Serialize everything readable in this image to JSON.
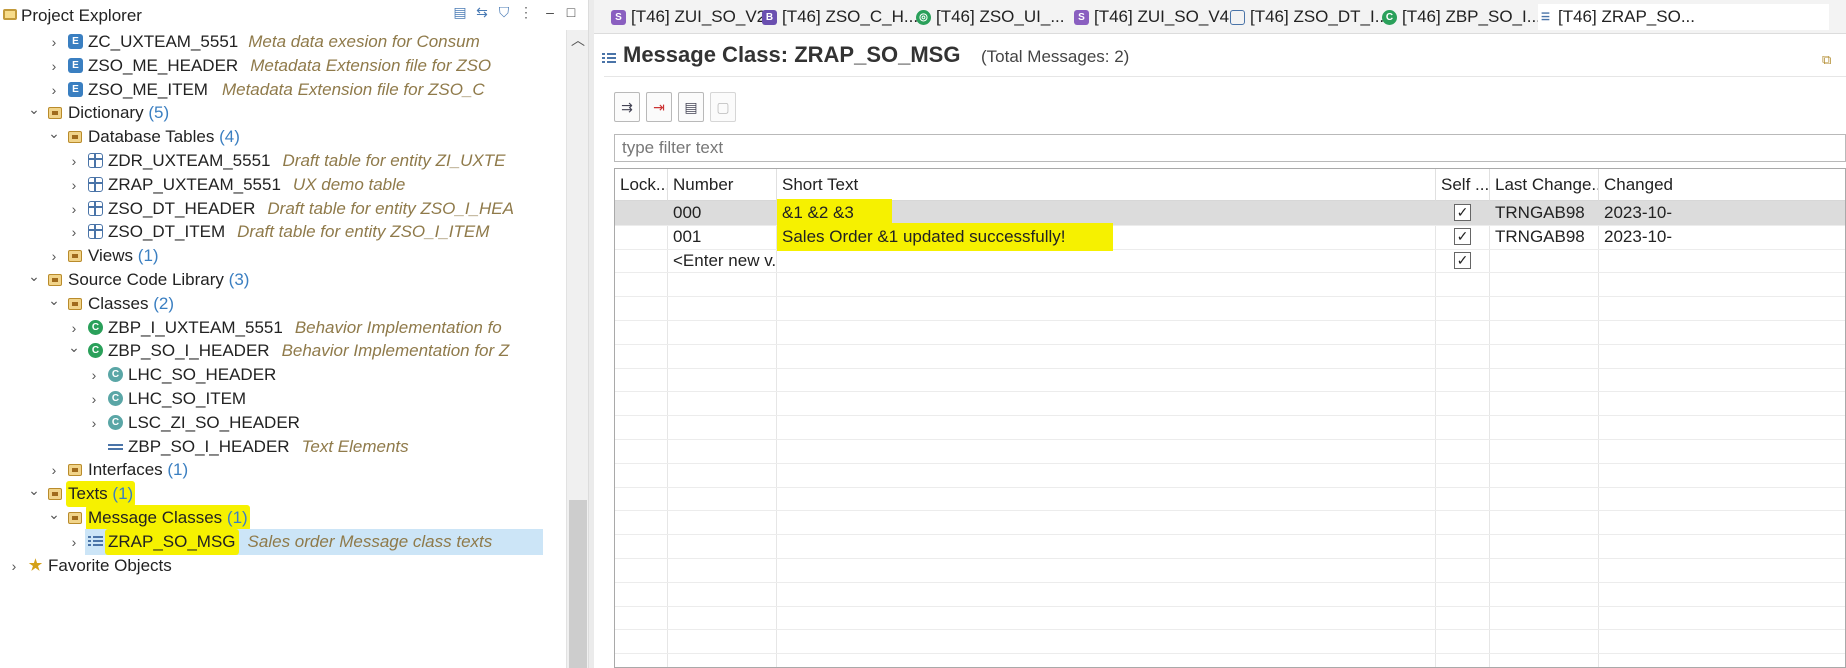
{
  "project_explorer": {
    "title": "Project Explorer",
    "tree": [
      {
        "id": "zc-uxteam",
        "name": "ZC_UXTEAM_5551",
        "desc": "Meta data exesion for Consum",
        "icon": "metadata-extension-icon",
        "expander": ">"
      },
      {
        "id": "zso-me-header",
        "name": "ZSO_ME_HEADER",
        "desc": "Metadata Extension file for ZSO",
        "icon": "metadata-extension-icon",
        "expander": ">"
      },
      {
        "id": "zso-me-item",
        "name": "ZSO_ME_ITEM",
        "desc": "Metadata Extension file for ZSO_C",
        "icon": "metadata-extension-icon",
        "expander": ">"
      },
      {
        "id": "dictionary",
        "name": "Dictionary",
        "count": "(5)",
        "icon": "package-folder-icon",
        "expander": "v"
      },
      {
        "id": "database-tables",
        "name": "Database Tables",
        "count": "(4)",
        "icon": "package-folder-icon",
        "expander": "v"
      },
      {
        "id": "zdr-uxteam",
        "name": "ZDR_UXTEAM_5551",
        "desc": "Draft table for entity ZI_UXTE",
        "icon": "table-icon",
        "expander": ">"
      },
      {
        "id": "zrap-uxteam",
        "name": "ZRAP_UXTEAM_5551",
        "desc": "UX demo table",
        "icon": "table-icon",
        "expander": ">"
      },
      {
        "id": "zso-dt-header",
        "name": "ZSO_DT_HEADER",
        "desc": "Draft table for entity ZSO_I_HEA",
        "icon": "table-icon",
        "expander": ">"
      },
      {
        "id": "zso-dt-item",
        "name": "ZSO_DT_ITEM",
        "desc": "Draft table for entity ZSO_I_ITEM",
        "icon": "table-icon",
        "expander": ">"
      },
      {
        "id": "views",
        "name": "Views",
        "count": "(1)",
        "icon": "package-folder-icon",
        "expander": ">"
      },
      {
        "id": "source-code-library",
        "name": "Source Code Library",
        "count": "(3)",
        "icon": "package-folder-icon",
        "expander": "v"
      },
      {
        "id": "classes",
        "name": "Classes",
        "count": "(2)",
        "icon": "package-folder-icon",
        "expander": "v"
      },
      {
        "id": "zbp-i-uxteam",
        "name": "ZBP_I_UXTEAM_5551",
        "desc": "Behavior Implementation fo",
        "icon": "class-icon",
        "expander": ">"
      },
      {
        "id": "zbp-so-i-header",
        "name": "ZBP_SO_I_HEADER",
        "desc": "Behavior Implementation for Z",
        "icon": "class-icon",
        "expander": "v"
      },
      {
        "id": "lhc-so-header",
        "name": "LHC_SO_HEADER",
        "icon": "local-class-icon",
        "expander": ">"
      },
      {
        "id": "lhc-so-item",
        "name": "LHC_SO_ITEM",
        "icon": "local-class-icon",
        "expander": ">"
      },
      {
        "id": "lsc-zi-so-header",
        "name": "LSC_ZI_SO_HEADER",
        "icon": "local-class-icon",
        "expander": ">"
      },
      {
        "id": "zbp-text-elements",
        "name": "ZBP_SO_I_HEADER",
        "desc": "Text Elements",
        "icon": "text-elements-icon",
        "expander": ""
      },
      {
        "id": "interfaces",
        "name": "Interfaces",
        "count": "(1)",
        "icon": "package-folder-icon",
        "expander": ">"
      },
      {
        "id": "texts",
        "name": "Texts",
        "count": "(1)",
        "icon": "package-folder-icon",
        "expander": "v"
      },
      {
        "id": "message-classes",
        "name": "Message Classes",
        "count": "(1)",
        "icon": "package-folder-icon",
        "expander": "v"
      },
      {
        "id": "zrap-so-msg",
        "name": "ZRAP_SO_MSG",
        "desc": "Sales order Message class texts",
        "icon": "message-class-icon",
        "expander": ">"
      },
      {
        "id": "favorite-objects",
        "name": "Favorite Objects",
        "icon": "star-icon",
        "expander": ">"
      }
    ]
  },
  "tabs": [
    {
      "label": "[T46] ZUI_SO_V2",
      "icon": "service-binding-icon",
      "color": "#8a5fc0"
    },
    {
      "label": "[T46] ZSO_C_H...",
      "icon": "behavior-definition-icon",
      "color": "#6a4fb0"
    },
    {
      "label": "[T46] ZSO_UI_...",
      "icon": "service-definition-icon",
      "color": "#2aa05a"
    },
    {
      "label": "[T46] ZUI_SO_V4",
      "icon": "service-binding-icon",
      "color": "#8a5fc0"
    },
    {
      "label": "[T46] ZSO_DT_I...",
      "icon": "table-icon",
      "color": "#4a74a8"
    },
    {
      "label": "[T46] ZBP_SO_I...",
      "icon": "class-icon",
      "color": "#2aa05a"
    },
    {
      "label": "[T46] ZRAP_SO...",
      "icon": "message-class-icon",
      "color": "#4a74a8"
    }
  ],
  "editor": {
    "title": "Message Class: ZRAP_SO_MSG",
    "total": "(Total Messages: 2)",
    "filter_placeholder": "type filter text",
    "columns": [
      "Lock...",
      "Number",
      "Short Text",
      "Self ...",
      "Last Change...",
      "Changed"
    ],
    "rows": [
      {
        "lock": "",
        "number": "000",
        "short_text": "&1 &2 &3",
        "self_explanatory": true,
        "last_changed_by": "TRNGAB98",
        "changed": "2023-10-"
      },
      {
        "lock": "",
        "number": "001",
        "short_text": "Sales Order &1 updated successfully!",
        "self_explanatory": true,
        "last_changed_by": "TRNGAB98",
        "changed": "2023-10-"
      },
      {
        "lock": "",
        "number": "<Enter new v...",
        "short_text": "",
        "self_explanatory": true,
        "last_changed_by": "",
        "changed": ""
      }
    ]
  },
  "colors": {
    "highlight": "#f6f100",
    "selection": "#cce5f7",
    "count_blue": "#3b7fc1",
    "description": "#8f7a4a"
  }
}
